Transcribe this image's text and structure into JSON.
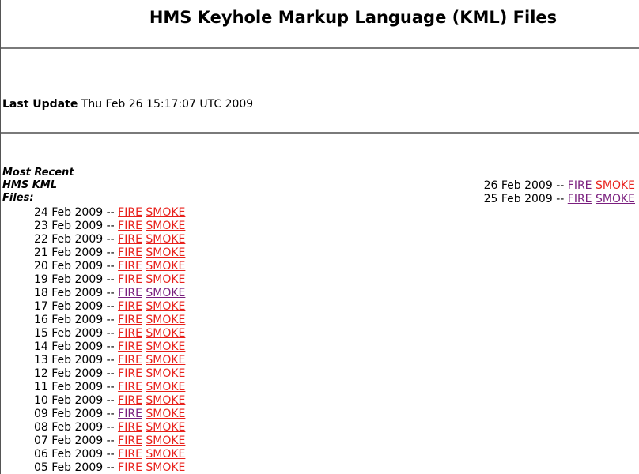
{
  "page": {
    "title": "HMS Keyhole Markup Language (KML) Files"
  },
  "last_update": {
    "label": "Last Update",
    "value": "Thu Feb 26 15:17:07 UTC 2009"
  },
  "recent_label": {
    "line1": "Most Recent",
    "line2": "HMS KML",
    "line3": "Files:"
  },
  "colors": {
    "link_unvisited": "#e8201b",
    "link_visited": "#7a1e7e"
  },
  "right_files": [
    {
      "date": "26 Feb 2009",
      "sep": "--",
      "fire": "FIRE",
      "smoke": "SMOKE",
      "fire_visited": true,
      "smoke_visited": false
    },
    {
      "date": "25 Feb 2009",
      "sep": "--",
      "fire": "FIRE",
      "smoke": "SMOKE",
      "fire_visited": true,
      "smoke_visited": true
    }
  ],
  "files": [
    {
      "date": "24 Feb 2009",
      "sep": "--",
      "fire": "FIRE",
      "smoke": "SMOKE",
      "fire_visited": false,
      "smoke_visited": false
    },
    {
      "date": "23 Feb 2009",
      "sep": "--",
      "fire": "FIRE",
      "smoke": "SMOKE",
      "fire_visited": false,
      "smoke_visited": false
    },
    {
      "date": "22 Feb 2009",
      "sep": "--",
      "fire": "FIRE",
      "smoke": "SMOKE",
      "fire_visited": false,
      "smoke_visited": false
    },
    {
      "date": "21 Feb 2009",
      "sep": "--",
      "fire": "FIRE",
      "smoke": "SMOKE",
      "fire_visited": false,
      "smoke_visited": false
    },
    {
      "date": "20 Feb 2009",
      "sep": "--",
      "fire": "FIRE",
      "smoke": "SMOKE",
      "fire_visited": false,
      "smoke_visited": false
    },
    {
      "date": "19 Feb 2009",
      "sep": "--",
      "fire": "FIRE",
      "smoke": "SMOKE",
      "fire_visited": false,
      "smoke_visited": false
    },
    {
      "date": "18 Feb 2009",
      "sep": "--",
      "fire": "FIRE",
      "smoke": "SMOKE",
      "fire_visited": true,
      "smoke_visited": true
    },
    {
      "date": "17 Feb 2009",
      "sep": "--",
      "fire": "FIRE",
      "smoke": "SMOKE",
      "fire_visited": false,
      "smoke_visited": false
    },
    {
      "date": "16 Feb 2009",
      "sep": "--",
      "fire": "FIRE",
      "smoke": "SMOKE",
      "fire_visited": false,
      "smoke_visited": false
    },
    {
      "date": "15 Feb 2009",
      "sep": "--",
      "fire": "FIRE",
      "smoke": "SMOKE",
      "fire_visited": false,
      "smoke_visited": false
    },
    {
      "date": "14 Feb 2009",
      "sep": "--",
      "fire": "FIRE",
      "smoke": "SMOKE",
      "fire_visited": false,
      "smoke_visited": false
    },
    {
      "date": "13 Feb 2009",
      "sep": "--",
      "fire": "FIRE",
      "smoke": "SMOKE",
      "fire_visited": false,
      "smoke_visited": false
    },
    {
      "date": "12 Feb 2009",
      "sep": "--",
      "fire": "FIRE",
      "smoke": "SMOKE",
      "fire_visited": false,
      "smoke_visited": false
    },
    {
      "date": "11 Feb 2009",
      "sep": "--",
      "fire": "FIRE",
      "smoke": "SMOKE",
      "fire_visited": false,
      "smoke_visited": false
    },
    {
      "date": "10 Feb 2009",
      "sep": "--",
      "fire": "FIRE",
      "smoke": "SMOKE",
      "fire_visited": false,
      "smoke_visited": false
    },
    {
      "date": "09 Feb 2009",
      "sep": "--",
      "fire": "FIRE",
      "smoke": "SMOKE",
      "fire_visited": true,
      "smoke_visited": false
    },
    {
      "date": "08 Feb 2009",
      "sep": "--",
      "fire": "FIRE",
      "smoke": "SMOKE",
      "fire_visited": false,
      "smoke_visited": false
    },
    {
      "date": "07 Feb 2009",
      "sep": "--",
      "fire": "FIRE",
      "smoke": "SMOKE",
      "fire_visited": false,
      "smoke_visited": false
    },
    {
      "date": "06 Feb 2009",
      "sep": "--",
      "fire": "FIRE",
      "smoke": "SMOKE",
      "fire_visited": false,
      "smoke_visited": false
    },
    {
      "date": "05 Feb 2009",
      "sep": "--",
      "fire": "FIRE",
      "smoke": "SMOKE",
      "fire_visited": false,
      "smoke_visited": false
    }
  ]
}
